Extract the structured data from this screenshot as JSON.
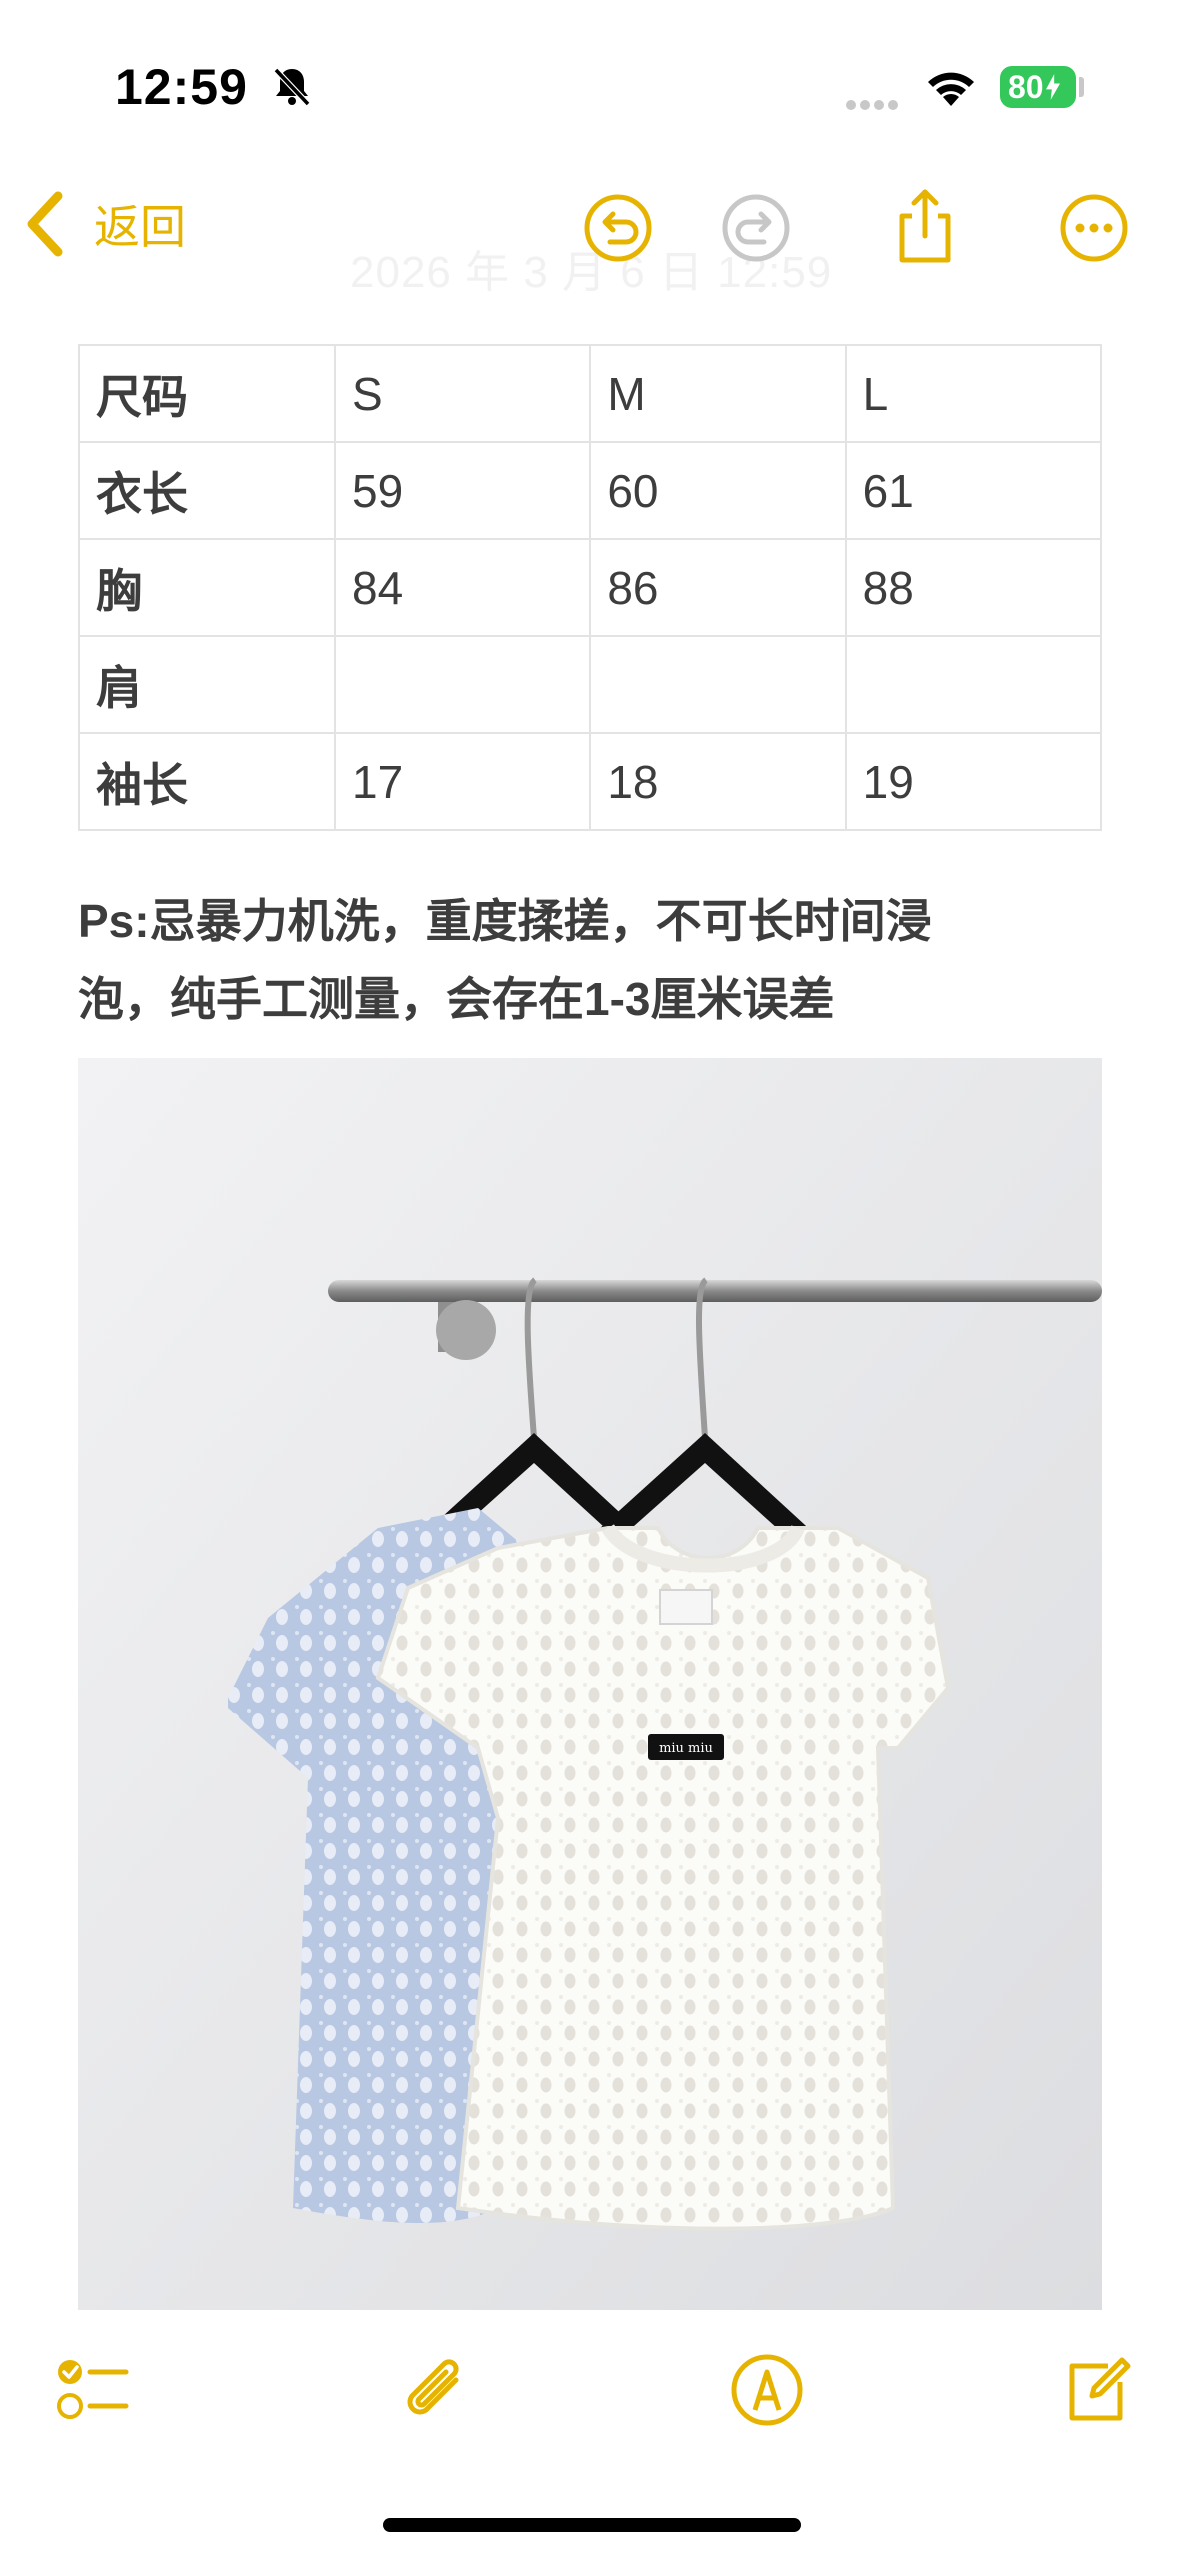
{
  "status_bar": {
    "time": "12:59",
    "battery": "80",
    "icons": [
      "bell-slash-icon",
      "cellular-icon",
      "wifi-icon",
      "battery-charging-icon"
    ]
  },
  "nav": {
    "back_label": "返回",
    "faint_title": "2026 年 3 月 6 日 12:59",
    "icons": [
      "chevron-left-icon",
      "undo-icon",
      "redo-icon",
      "share-icon",
      "more-icon"
    ]
  },
  "size_table": {
    "rows": [
      {
        "label": "尺码",
        "values": [
          "S",
          "M",
          "L"
        ]
      },
      {
        "label": "衣长",
        "values": [
          "59",
          "60",
          "61"
        ]
      },
      {
        "label": "胸",
        "values": [
          "84",
          "86",
          "88"
        ]
      },
      {
        "label": "肩",
        "values": [
          "",
          "",
          ""
        ]
      },
      {
        "label": "袖长",
        "values": [
          "17",
          "18",
          "19"
        ]
      }
    ]
  },
  "note": {
    "line1": "Ps:忌暴力机洗，重度揉搓，不可长时间浸",
    "line2": "泡，纯手工测量，会存在1-3厘米误差"
  },
  "photo": {
    "label_tag": "miu miu"
  },
  "toolbar": {
    "icons": [
      "checklist-icon",
      "paperclip-icon",
      "markup-pen-icon",
      "compose-icon"
    ]
  },
  "colors": {
    "accent": "#e6b400",
    "disabled": "#c7c7c7",
    "text": "#3d3d3d",
    "battery": "#34c759"
  }
}
